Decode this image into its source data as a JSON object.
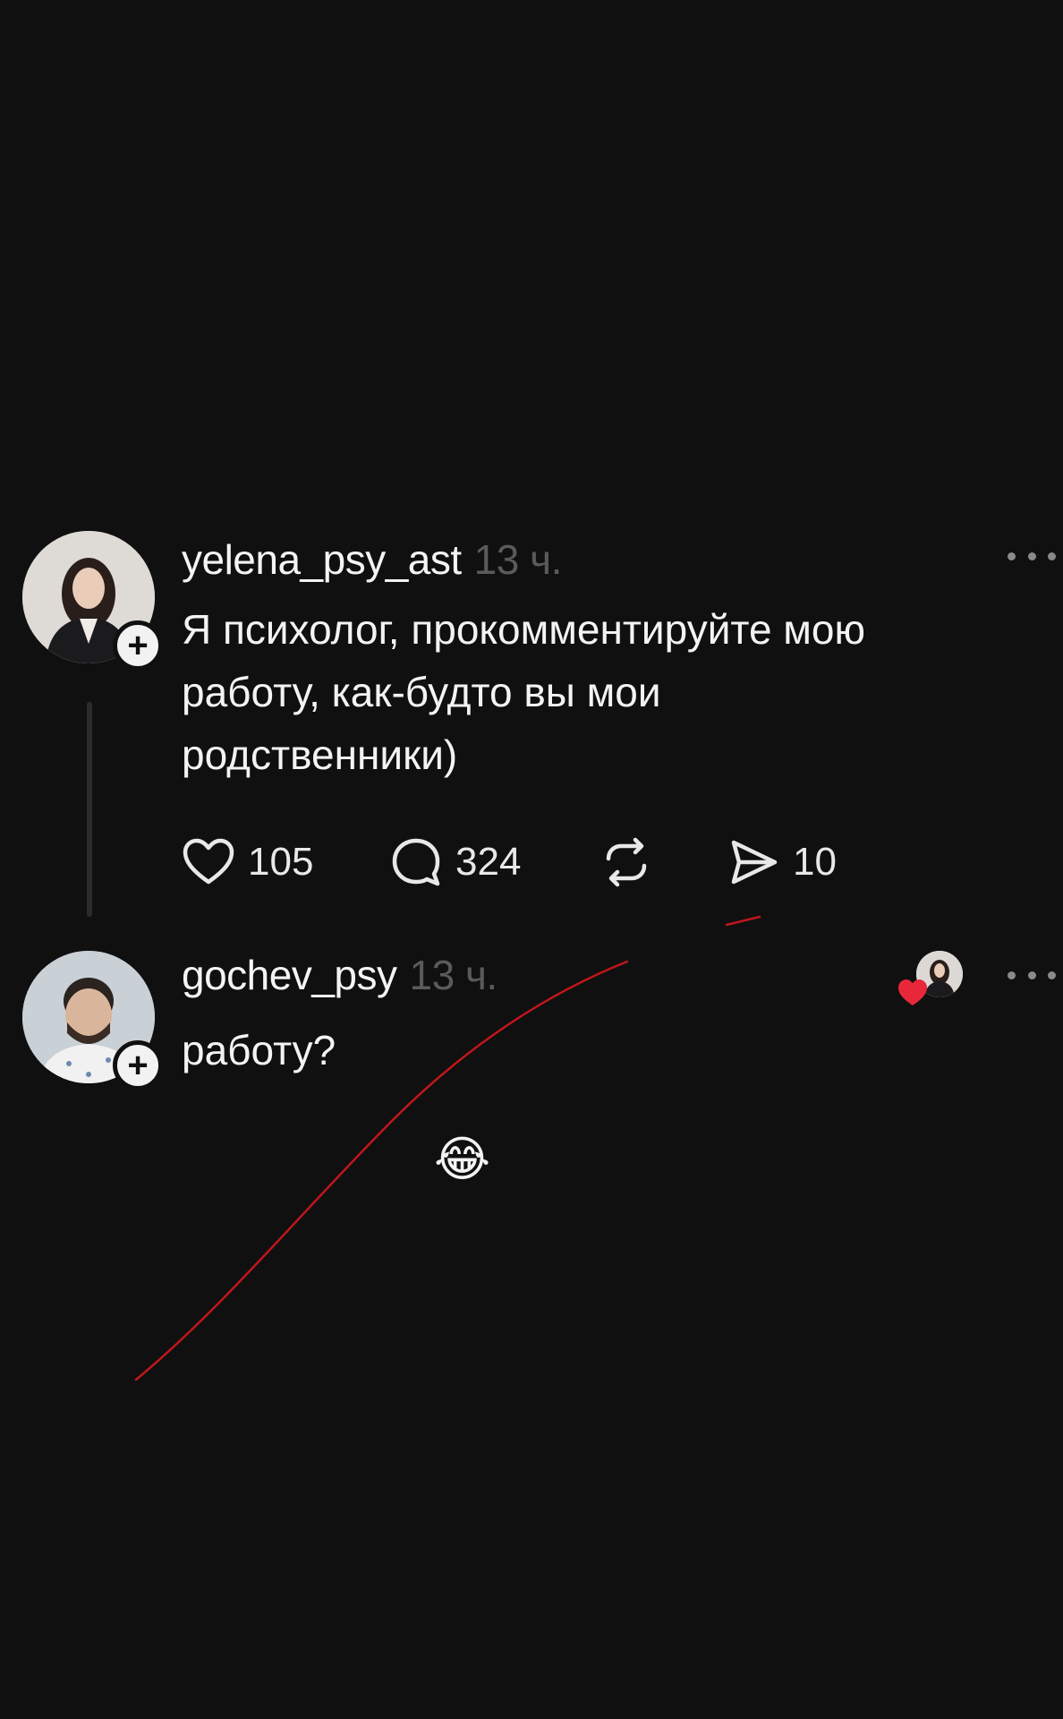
{
  "post": {
    "username": "yelena_psy_ast",
    "time": "13 ч.",
    "text": "Я психолог, прокомментируйте мою\nработу, как-будто вы мои\nродственники)",
    "likes": "105",
    "comments": "324",
    "shares": "10",
    "icons": {
      "like": "heart-icon",
      "comment": "comment-icon",
      "repost": "repost-icon",
      "share": "send-icon",
      "more": "more-icon",
      "follow": "plus-icon"
    }
  },
  "reply": {
    "username": "gochev_psy",
    "time": "13 ч.",
    "text": "работу?",
    "liked_by_author": true
  },
  "overlay": {
    "emoji": "😂",
    "pen_color": "#c0161b"
  }
}
